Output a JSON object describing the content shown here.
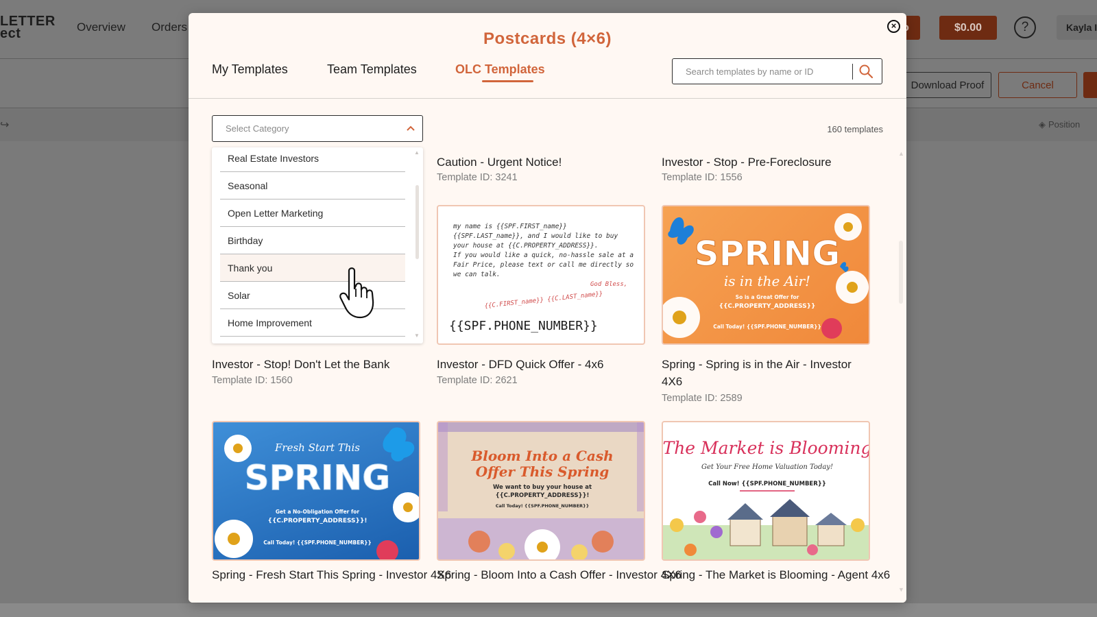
{
  "app": {
    "logo_line1": "LETTER",
    "logo_line2": "ect",
    "nav": [
      "Overview",
      "Orders"
    ],
    "balance": "$0.00",
    "partial_button": "o",
    "help": "?",
    "user": "Kayla I",
    "download_proof": "Download Proof",
    "cancel": "Cancel",
    "position": "Position"
  },
  "modal": {
    "title": "Postcards (4×6)",
    "tabs": [
      "My Templates",
      "Team Templates",
      "OLC Templates"
    ],
    "active_tab": "OLC Templates",
    "search_placeholder": "Search templates by name or ID",
    "category_placeholder": "Select Category",
    "template_count": "160 templates"
  },
  "categories": [
    "Real Estate Investors",
    "Seasonal",
    "Open Letter Marketing",
    "Birthday",
    "Thank you",
    "Solar",
    "Home Improvement"
  ],
  "hovered_category": "Thank you",
  "templates_row0": [
    {
      "title": "Caution - Urgent Notice!",
      "id": "Template ID: 3241"
    },
    {
      "title": "Investor - Stop - Pre-Foreclosure",
      "id": "Template ID: 1556"
    }
  ],
  "templates_row1": [
    {
      "title": "Investor - Stop! Don't Let the Bank",
      "id": "Template ID: 1560"
    },
    {
      "title": "Investor - DFD Quick Offer - 4x6",
      "id": "Template ID: 2621"
    },
    {
      "title": "Spring - Spring is in the Air - Investor 4X6",
      "id": "Template ID: 2589"
    }
  ],
  "templates_row2": [
    {
      "title": "Spring - Fresh Start This Spring - Investor 4X6"
    },
    {
      "title": "Spring - Bloom Into a Cash Offer - Investor 4X6"
    },
    {
      "title": "Spring - The Market is Blooming - Agent 4x6"
    }
  ],
  "thumbs": {
    "dfd": {
      "lines": [
        "my name is {{SPF.FIRST_name}}",
        "{{SPF.LAST_name}}, and I would like to buy",
        "your house at {{C.PROPERTY_ADDRESS}}.",
        "If you would like a quick, no-hassle sale at a",
        "Fair Price, please text or call me directly so",
        "we can talk."
      ],
      "bless": "God Bless,",
      "sign": "{{C.FIRST_name}} {{C.LAST_name}}",
      "phone": "{{SPF.PHONE_NUMBER}}"
    },
    "spring_air": {
      "big": "SPRING",
      "script": "is in the Air!",
      "offer": "So is a Great Offer for",
      "addr": "{{C.PROPERTY_ADDRESS}}",
      "call": "Call Today! {{SPF.PHONE_NUMBER}}"
    },
    "fresh": {
      "script": "Fresh Start This",
      "big": "SPRING",
      "offer": "Get a No-Obligation Offer for",
      "addr": "{{C.PROPERTY_ADDRESS}}!",
      "call": "Call Today! {{SPF.PHONE_NUMBER}}"
    },
    "bloom": {
      "title1": "Bloom Into a Cash",
      "title2": "Offer This Spring",
      "body1": "We want to buy your house at",
      "body2": "{{C.PROPERTY_ADDRESS}}!",
      "call": "Call Today! {{SPF.PHONE_NUMBER}}"
    },
    "market": {
      "title": "The Market is Blooming",
      "sub": "Get Your Free Home Valuation Today!",
      "call": "Call Now! {{SPF.PHONE_NUMBER}}"
    }
  },
  "colors": {
    "accent": "#d1653b",
    "modal_bg": "#fff8f3",
    "thumb_border": "#f0c6b2"
  }
}
